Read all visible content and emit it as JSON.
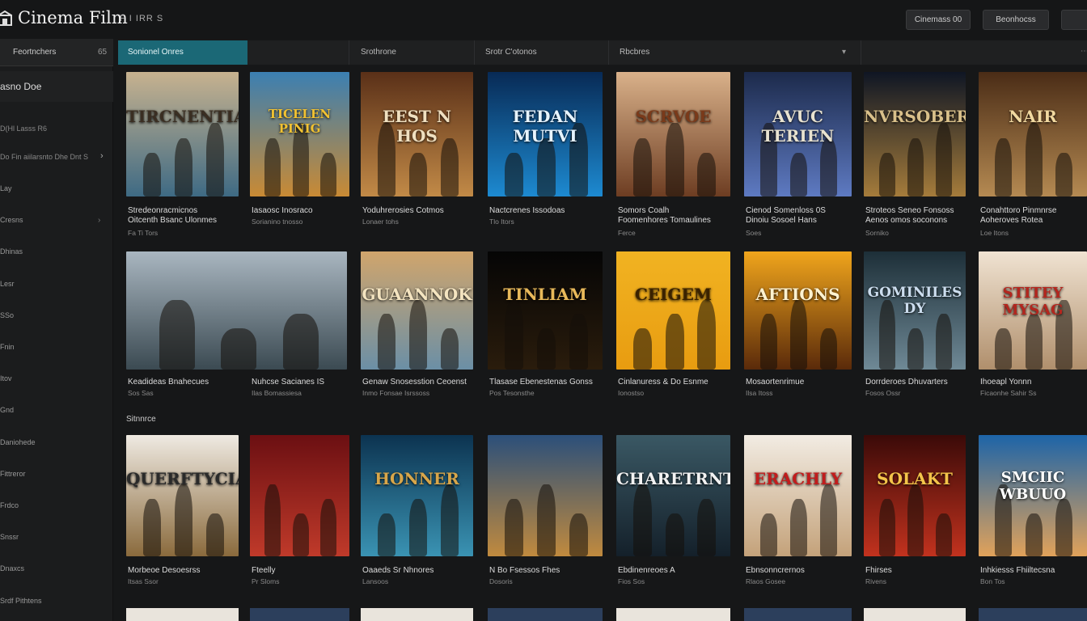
{
  "app": {
    "title": "Cinema Film",
    "subtitle": "F I IRR S"
  },
  "header": {
    "btn1": "Cinemass 00",
    "btn2": "Beonhocss"
  },
  "sidebar": {
    "head_label": "Feortnchers",
    "head_num": "65",
    "box_label": "asno Doe",
    "section": "D(Hl Lasss R6",
    "select_label": "Do Fin aiilarsnto Dhe Dnt S",
    "items": [
      "Lay",
      "Cresns",
      "Dhinas",
      "Lesr",
      "SSo",
      "Fnin",
      "Itov",
      "Gnd",
      "Daniohede",
      "Fittreror",
      "Frdco",
      "Snssr",
      "Dnaxcs",
      "Srdf Pithtens"
    ]
  },
  "tabs": [
    {
      "label": "Sonionel Onres"
    },
    {
      "label": ""
    },
    {
      "label": "Srothrone"
    },
    {
      "label": "Srotr C'otonos"
    },
    {
      "label": "Rbcbres"
    },
    {
      "label": ""
    }
  ],
  "section_label": "Sitnnrce",
  "posters": [
    {
      "title": "Stredeonracmicnos",
      "title2": "Oitcenth Bsanc Ulonmes",
      "meta": "Fa Ti Tors",
      "poster_text": "TIRCNENTIAL",
      "bg": "#c7b28f",
      "bg2": "#3e6a84",
      "tc": "#3a2e22"
    },
    {
      "title": "Iasaosc Inosraco",
      "title2": "",
      "meta": "Sorianino tnosso",
      "poster_text": "TICELEN PINIG",
      "bg": "#3b7fb2",
      "bg2": "#c98a34",
      "tc": "#f1c232"
    },
    {
      "title": "Yoduhrerosies Cotmos",
      "title2": "",
      "meta": "Lonaer tohs",
      "poster_text": "EEST N HOS",
      "bg": "#5a3018",
      "bg2": "#c28a47",
      "tc": "#f0e0c0"
    },
    {
      "title": "Nactcrenes Issodoas",
      "title2": "",
      "meta": "Tlo Itors",
      "poster_text": "FEDAN MUTVI",
      "bg": "#082a55",
      "bg2": "#1d8ad1",
      "tc": "#e7f4ff"
    },
    {
      "title": "Somors Coalh",
      "title2": "Foomenhores Tomaulines",
      "meta": "Ferce",
      "poster_text": "SCRVOE",
      "bg": "#d9b18a",
      "bg2": "#6d3d22",
      "tc": "#7a3a1a"
    },
    {
      "title": "Cienod Somenloss 0S",
      "title2": "Dinoiu Sosoel Hans",
      "meta": "Soes",
      "poster_text": "AVUC TERIEN",
      "bg": "#1c2a4b",
      "bg2": "#5e7ac2",
      "tc": "#e8e2d0"
    },
    {
      "title": "Stroteos Seneo Fonsoss",
      "title2": "Aenos omos soconons",
      "meta": "Sorniko",
      "poster_text": "NVRSOBER",
      "bg": "#0f1624",
      "bg2": "#a57c3b",
      "tc": "#d9c08a"
    },
    {
      "title": "Conahttoro Pinmnrse",
      "title2": "Aoheroves Rotea",
      "meta": "Loe Itons",
      "poster_text": "NAIR",
      "bg": "#4a2c16",
      "bg2": "#b58a52",
      "tc": "#f2d9a0"
    },
    {
      "title": "Keadideas Bnahecues",
      "title2": "",
      "meta": "Sos Sas",
      "poster_text": "",
      "bg": "#a9b6c0",
      "bg2": "#3b4a52",
      "tc": "#eee"
    },
    {
      "title": "Nuhcse Sacianes IS",
      "title2": "",
      "meta": "Ilas Bomassiesa",
      "poster_text": "",
      "bg": "#a9b6c0",
      "bg2": "#3b4a52",
      "tc": "#eee"
    },
    {
      "title": "Genaw Snosesstion Ceoenst",
      "title2": "",
      "meta": "Inmo Fonsae Isrssoss",
      "poster_text": "GUAANNOK",
      "bg": "#d0a56c",
      "bg2": "#6b8fa6",
      "tc": "#f4e4c0"
    },
    {
      "title": "Tlasase Ebenestenas Gonss",
      "title2": "",
      "meta": "Pos Tesonsthe",
      "poster_text": "TINLIAM",
      "bg": "#050505",
      "bg2": "#2a1c0c",
      "tc": "#e8b95a"
    },
    {
      "title": "Cinlanuress & Do Esnme",
      "title2": "",
      "meta": "Ionostso",
      "poster_text": "CEIGEM",
      "bg": "#f1b322",
      "bg2": "#e89c10",
      "tc": "#3a2200"
    },
    {
      "title": "Mosaortenrimue",
      "title2": "",
      "meta": "Ilsa Itoss",
      "poster_text": "AFTIONS",
      "bg": "#f0a51c",
      "bg2": "#5a2a0a",
      "tc": "#fff2d0"
    },
    {
      "title": "Dorrderoes Dhuvarters",
      "title2": "",
      "meta": "Fosos Ossr",
      "poster_text": "GOMINILES DY",
      "bg": "#1d2f38",
      "bg2": "#6f8996",
      "tc": "#cde"
    },
    {
      "title": "Ihoeapl Yonnn",
      "title2": "",
      "meta": "Ficaonhe Sahir Ss",
      "poster_text": "STITEY MYSAG",
      "bg": "#f0e3d2",
      "bg2": "#b08f6c",
      "tc": "#b3261e"
    },
    {
      "title": "Morbeoe Desoesrss",
      "title2": "",
      "meta": "Itsas Ssor",
      "poster_text": "QUERFTYCIA",
      "bg": "#efeae2",
      "bg2": "#8a6a3c",
      "tc": "#2a2a2a"
    },
    {
      "title": "Fteelly",
      "title2": "",
      "meta": "Pr Sloms",
      "poster_text": "",
      "bg": "#6b0f12",
      "bg2": "#c03a2a",
      "tc": "#eee"
    },
    {
      "title": "Oaaeds Sr Nhnores",
      "title2": "",
      "meta": "Lansoos",
      "poster_text": "HONNER",
      "bg": "#0c3350",
      "bg2": "#3a93b3",
      "tc": "#d8a64a"
    },
    {
      "title": "N Bo Fsessos Fhes",
      "title2": "",
      "meta": "Dosoris",
      "poster_text": "",
      "bg": "#2b4f7a",
      "bg2": "#c08a3e",
      "tc": "#eee"
    },
    {
      "title": "Ebdinenreoes A",
      "title2": "",
      "meta": "Fios Sos",
      "poster_text": "CHARETRNT",
      "bg": "#3a5864",
      "bg2": "#14202a",
      "tc": "#f2f2f2"
    },
    {
      "title": "Ebnsonncrernos",
      "title2": "",
      "meta": "Rlaos Gosee",
      "poster_text": "ERACHLY",
      "bg": "#f2ece3",
      "bg2": "#c4a27a",
      "tc": "#c21c1c"
    },
    {
      "title": "Fhirses",
      "title2": "",
      "meta": "Rivens",
      "poster_text": "SOLAKT",
      "bg": "#3a0a08",
      "bg2": "#c2321e",
      "tc": "#f4c44a"
    },
    {
      "title": "Inhkiesss Fhiiltecsna",
      "title2": "",
      "meta": "Bon Tos",
      "poster_text": "SMCIIC WBUUO",
      "bg": "#1d64a8",
      "bg2": "#e1a25a",
      "tc": "#ffffff"
    }
  ]
}
